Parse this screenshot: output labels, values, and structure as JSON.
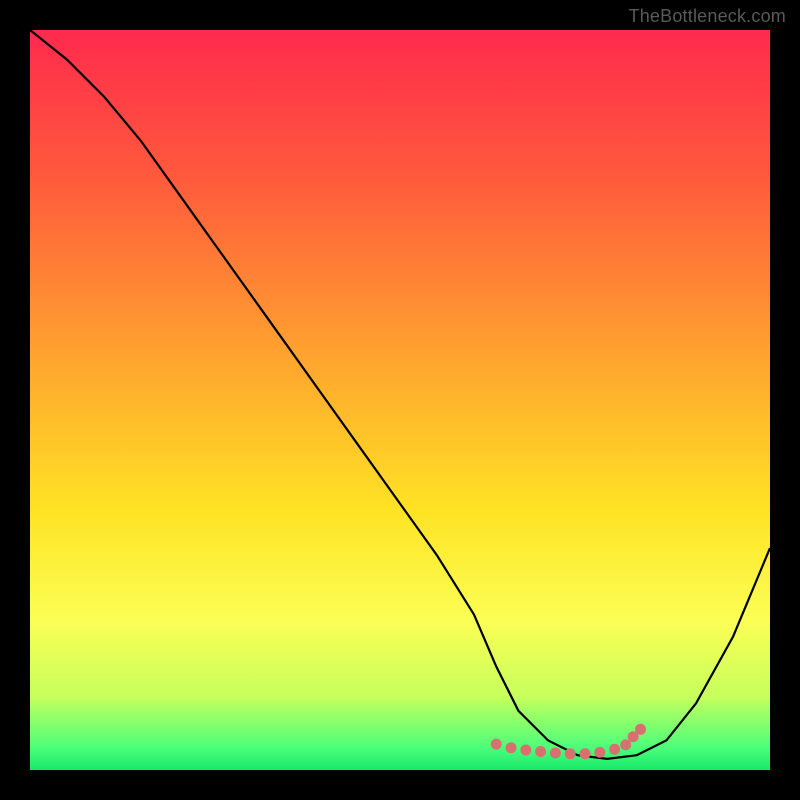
{
  "watermark": "TheBottleneck.com",
  "chart_data": {
    "type": "line",
    "title": "",
    "xlabel": "",
    "ylabel": "",
    "xlim": [
      0,
      100
    ],
    "ylim": [
      0,
      100
    ],
    "gradient_stops": [
      {
        "offset": 0,
        "color": "#ff2a4d"
      },
      {
        "offset": 20,
        "color": "#ff5a3c"
      },
      {
        "offset": 45,
        "color": "#ffa62e"
      },
      {
        "offset": 65,
        "color": "#ffe324"
      },
      {
        "offset": 80,
        "color": "#fbff55"
      },
      {
        "offset": 90,
        "color": "#c7ff5c"
      },
      {
        "offset": 97,
        "color": "#4bff7a"
      },
      {
        "offset": 100,
        "color": "#17e86b"
      }
    ],
    "series": [
      {
        "name": "bottleneck-curve",
        "stroke": "#000000",
        "x": [
          0,
          5,
          10,
          15,
          20,
          25,
          30,
          35,
          40,
          45,
          50,
          55,
          60,
          63,
          66,
          70,
          74,
          78,
          82,
          86,
          90,
          95,
          100
        ],
        "y": [
          100,
          96,
          91,
          85,
          78,
          71,
          64,
          57,
          50,
          43,
          36,
          29,
          21,
          14,
          8,
          4,
          2,
          1.5,
          2,
          4,
          9,
          18,
          30
        ]
      }
    ],
    "marker_cluster": {
      "name": "optimal-range",
      "color": "#d9706f",
      "points": [
        {
          "x": 63,
          "y": 3.5
        },
        {
          "x": 65,
          "y": 3.0
        },
        {
          "x": 67,
          "y": 2.7
        },
        {
          "x": 69,
          "y": 2.5
        },
        {
          "x": 71,
          "y": 2.3
        },
        {
          "x": 73,
          "y": 2.2
        },
        {
          "x": 75,
          "y": 2.2
        },
        {
          "x": 77,
          "y": 2.4
        },
        {
          "x": 79,
          "y": 2.8
        },
        {
          "x": 80.5,
          "y": 3.4
        },
        {
          "x": 81.5,
          "y": 4.5
        },
        {
          "x": 82.5,
          "y": 5.5
        }
      ]
    }
  }
}
